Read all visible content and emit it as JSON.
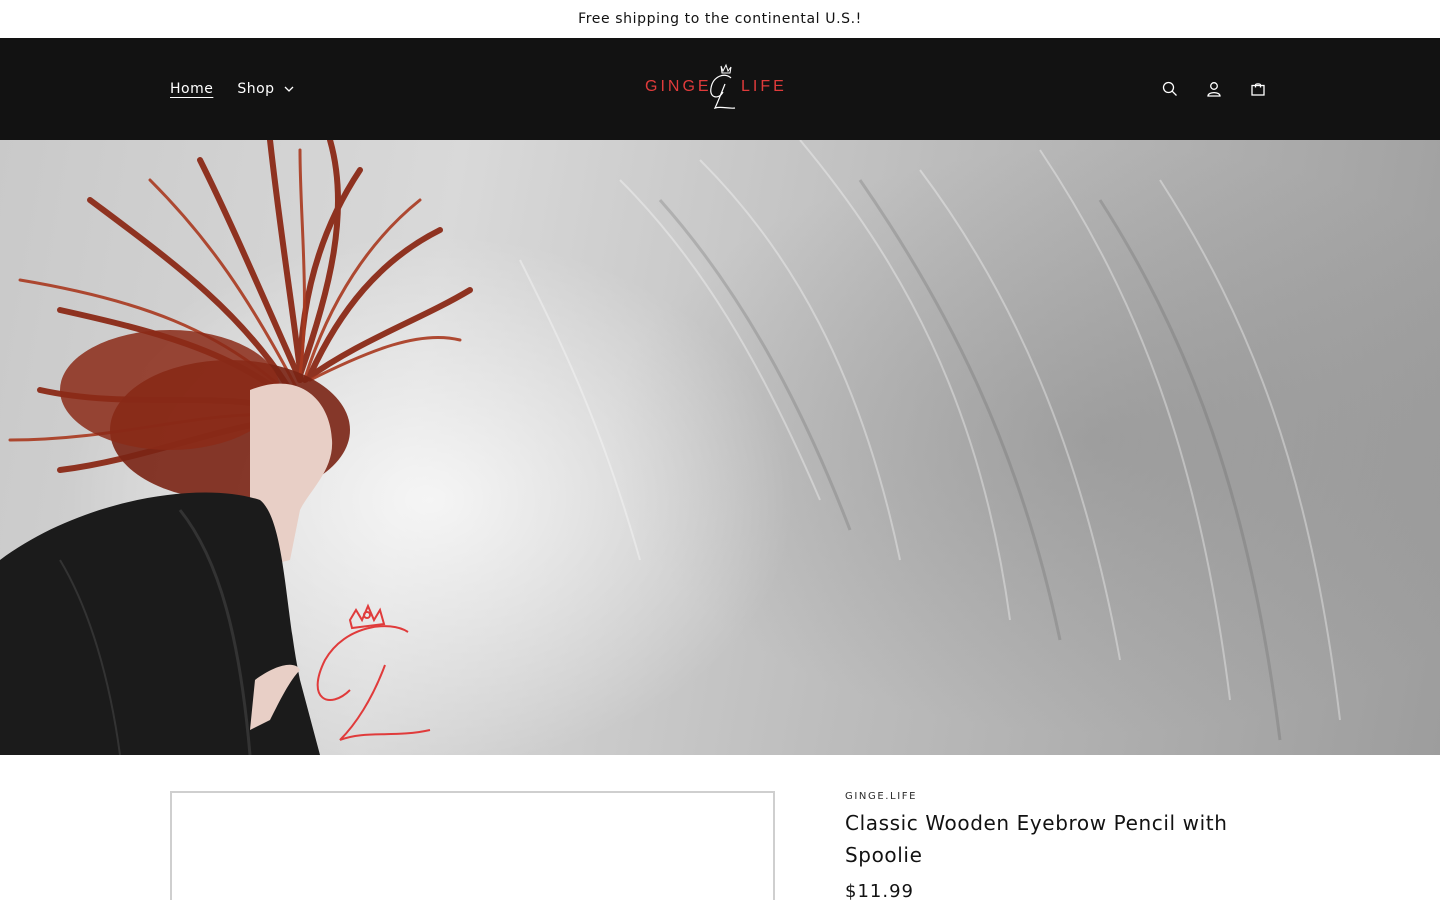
{
  "announcement": {
    "text": "Free shipping to the continental U.S.!"
  },
  "header": {
    "nav": [
      {
        "label": "Home",
        "active": true
      },
      {
        "label": "Shop",
        "has_dropdown": true
      }
    ],
    "logo": {
      "left_text": "GINGE",
      "right_text": "LIFE",
      "color": "#e03b3b"
    },
    "icons": [
      "search-icon",
      "account-icon",
      "cart-icon"
    ],
    "background": "#121212"
  },
  "hero": {
    "description_icons": [
      "ginge-life-monogram"
    ],
    "accent_color": "#e03b3b",
    "hair_color": "#8b2a17"
  },
  "product": {
    "vendor": "GINGE.LIFE",
    "title": "Classic Wooden Eyebrow Pencil with Spoolie",
    "price": "$11.99"
  }
}
